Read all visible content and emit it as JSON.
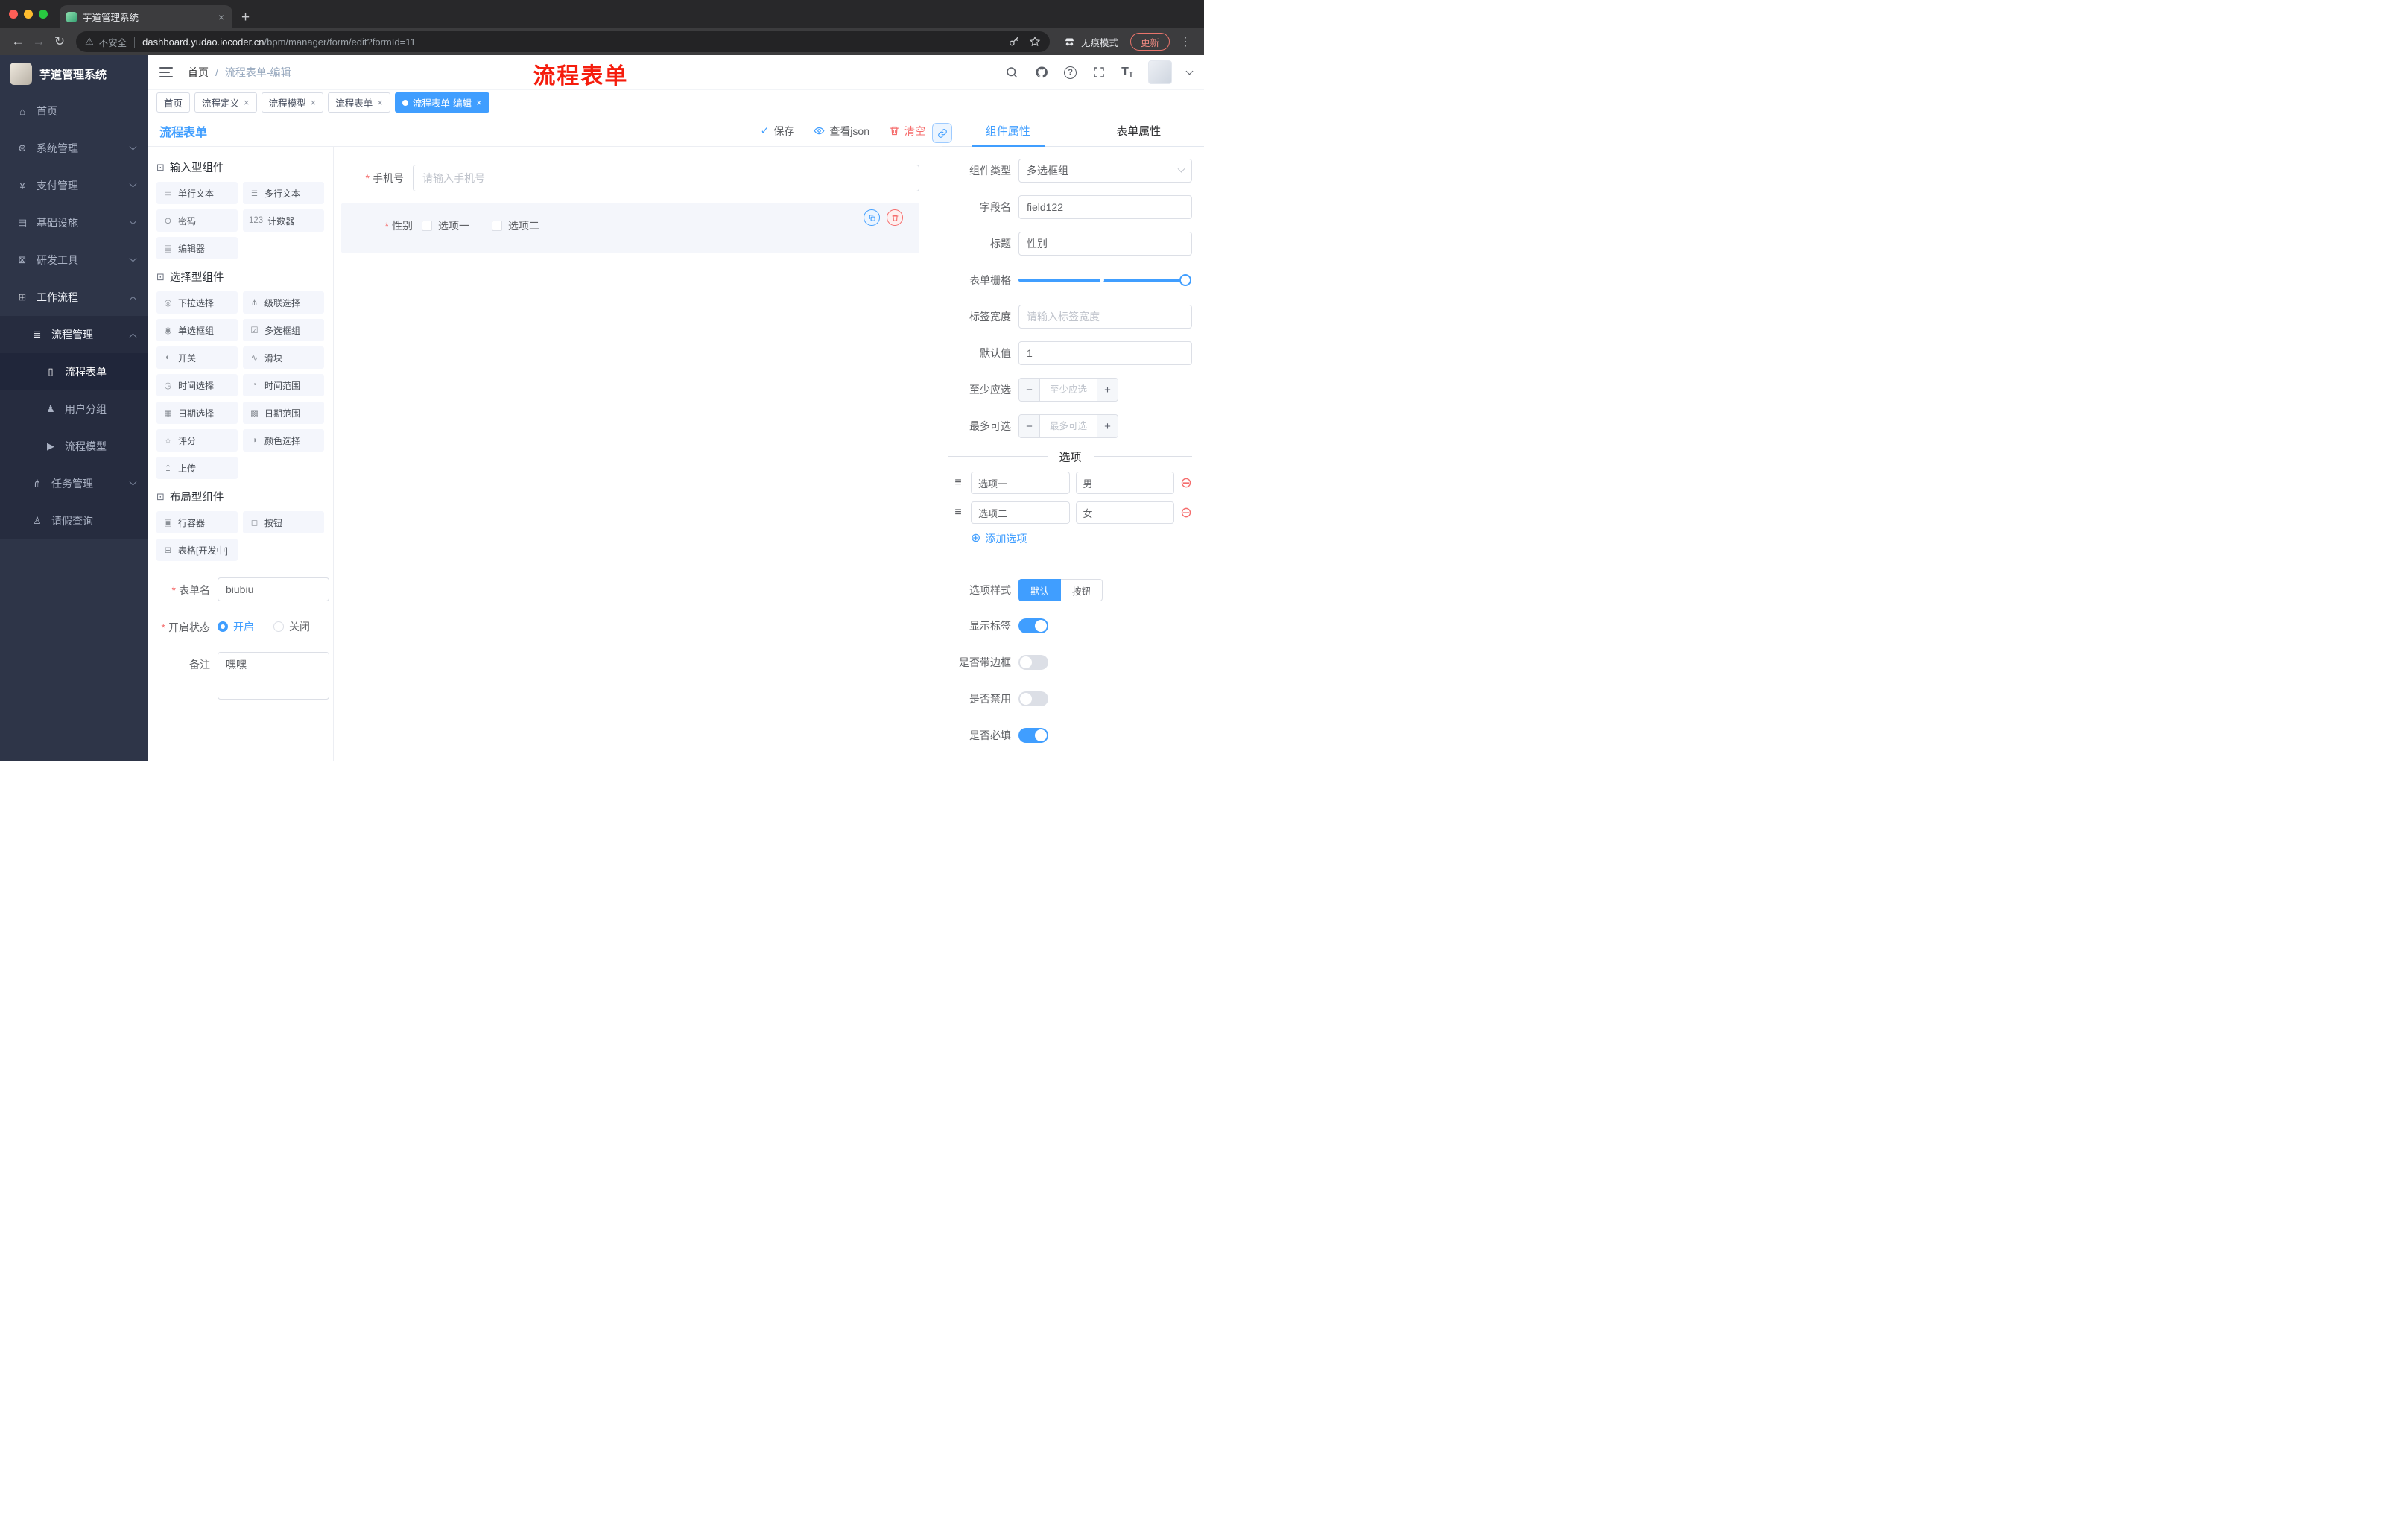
{
  "browser": {
    "tab_title": "芋道管理系统",
    "security_label": "不安全",
    "url_domain": "dashboard.yudao.iocoder.cn",
    "url_path": "/bpm/manager/form/edit?formId=11",
    "incognito_label": "无痕模式",
    "update_label": "更新"
  },
  "sidebar": {
    "logo_title": "芋道管理系统",
    "items": [
      {
        "label": "首页",
        "glyph": "⌂"
      },
      {
        "label": "系统管理",
        "glyph": "⊛"
      },
      {
        "label": "支付管理",
        "glyph": "¥"
      },
      {
        "label": "基础设施",
        "glyph": "▤"
      },
      {
        "label": "研发工具",
        "glyph": "⊠"
      },
      {
        "label": "工作流程",
        "glyph": "⊞"
      },
      {
        "label": "流程管理",
        "glyph": "≣"
      },
      {
        "label": "流程表单",
        "glyph": "▯"
      },
      {
        "label": "用户分组",
        "glyph": "♟"
      },
      {
        "label": "流程模型",
        "glyph": "▶"
      },
      {
        "label": "任务管理",
        "glyph": "⋔"
      },
      {
        "label": "请假查询",
        "glyph": "♙"
      }
    ]
  },
  "header": {
    "breadcrumb": [
      "首页",
      "流程表单-编辑"
    ],
    "annotation": "流程表单",
    "annotation_color": "#f51d0d"
  },
  "tags": [
    {
      "label": "首页"
    },
    {
      "label": "流程定义"
    },
    {
      "label": "流程模型"
    },
    {
      "label": "流程表单"
    },
    {
      "label": "流程表单-编辑"
    }
  ],
  "designer": {
    "title": "流程表单",
    "accent_color": "#409eff",
    "danger_color": "#f56c6c",
    "actions": {
      "save": "保存",
      "view_json": "查看json",
      "clear": "清空"
    },
    "component_groups": [
      {
        "title": "输入型组件",
        "items": [
          {
            "label": "单行文本",
            "glyph": "▭"
          },
          {
            "label": "多行文本",
            "glyph": "≣"
          },
          {
            "label": "密码",
            "glyph": "⊙"
          },
          {
            "label": "计数器",
            "glyph": "123"
          },
          {
            "label": "编辑器",
            "glyph": "▤"
          }
        ]
      },
      {
        "title": "选择型组件",
        "items": [
          {
            "label": "下拉选择",
            "glyph": "◎"
          },
          {
            "label": "级联选择",
            "glyph": "⋔"
          },
          {
            "label": "单选框组",
            "glyph": "◉"
          },
          {
            "label": "多选框组",
            "glyph": "☑"
          },
          {
            "label": "开关",
            "glyph": "◐"
          },
          {
            "label": "滑块",
            "glyph": "∿"
          },
          {
            "label": "时间选择",
            "glyph": "◷"
          },
          {
            "label": "时间范围",
            "glyph": "◔"
          },
          {
            "label": "日期选择",
            "glyph": "▦"
          },
          {
            "label": "日期范围",
            "glyph": "▩"
          },
          {
            "label": "评分",
            "glyph": "☆"
          },
          {
            "label": "颜色选择",
            "glyph": "◑"
          },
          {
            "label": "上传",
            "glyph": "↥"
          }
        ]
      },
      {
        "title": "布局型组件",
        "items": [
          {
            "label": "行容器",
            "glyph": "▣"
          },
          {
            "label": "按钮",
            "glyph": "◻"
          },
          {
            "label": "表格[开发中]",
            "glyph": "⊞"
          }
        ]
      }
    ],
    "form_meta": {
      "name_label": "表单名",
      "name_value": "biubiu",
      "status_label": "开启状态",
      "status_on": "开启",
      "status_off": "关闭",
      "remark_label": "备注",
      "remark_value": "嘿嘿"
    },
    "canvas": {
      "phone_label": "手机号",
      "phone_placeholder": "请输入手机号",
      "gender_label": "性别",
      "gender_options": [
        "选项一",
        "选项二"
      ]
    }
  },
  "properties": {
    "tab_component": "组件属性",
    "tab_form": "表单属性",
    "component_type_label": "组件类型",
    "component_type_value": "多选框组",
    "field_name_label": "字段名",
    "field_name_value": "field122",
    "title_label": "标题",
    "title_value": "性别",
    "grid_label": "表单栅格",
    "label_width_label": "标签宽度",
    "label_width_placeholder": "请输入标签宽度",
    "default_label": "默认值",
    "default_value": "1",
    "min_label": "至少应选",
    "min_placeholder": "至少应选",
    "max_label": "最多可选",
    "max_placeholder": "最多可选",
    "options_title": "选项",
    "options": [
      {
        "label": "选项一",
        "value": "男"
      },
      {
        "label": "选项二",
        "value": "女"
      }
    ],
    "add_option_label": "添加选项",
    "option_style_label": "选项样式",
    "style_default": "默认",
    "style_button": "按钮",
    "toggles": [
      {
        "label": "显示标签",
        "on": true
      },
      {
        "label": "是否带边框",
        "on": false
      },
      {
        "label": "是否禁用",
        "on": false
      },
      {
        "label": "是否必填",
        "on": true
      }
    ]
  }
}
